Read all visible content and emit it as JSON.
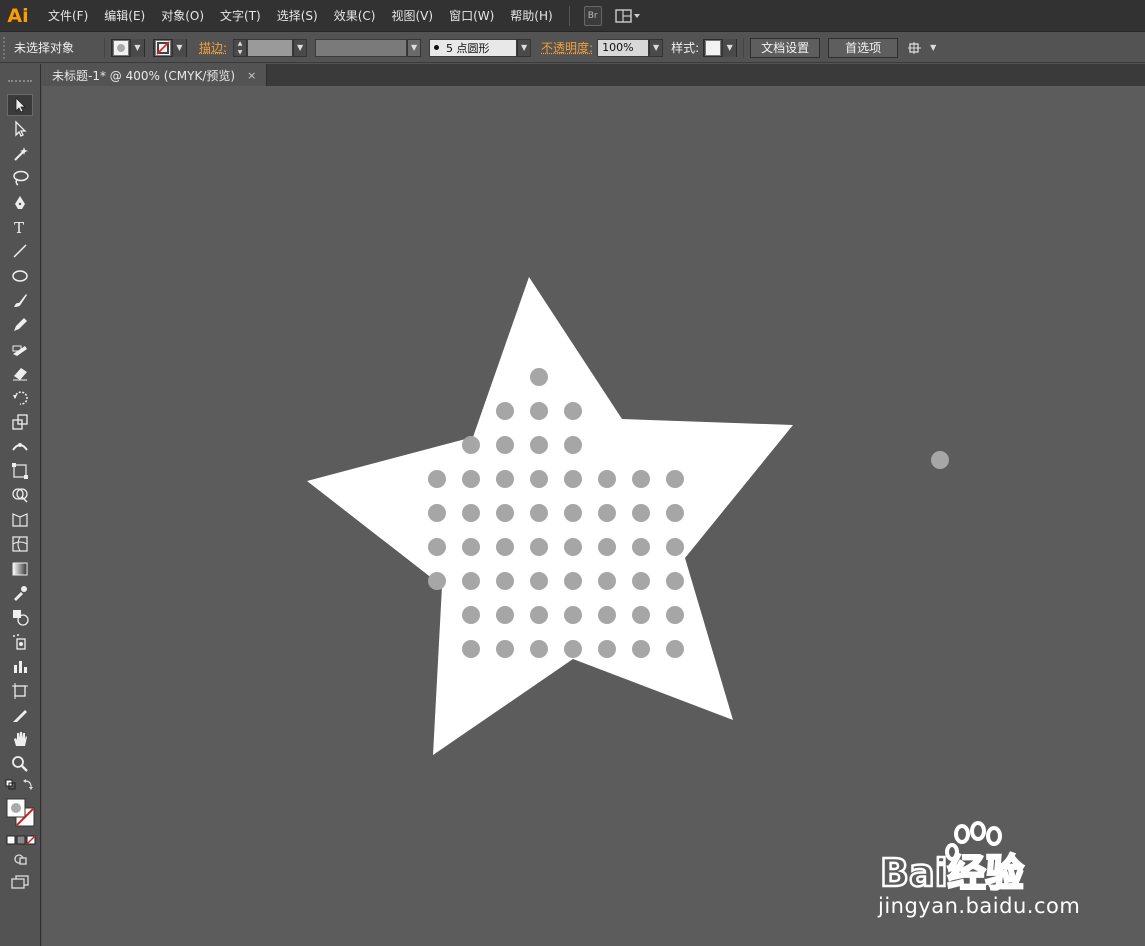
{
  "app": {
    "logo": "Ai",
    "accent_color": "#ff9a00"
  },
  "menu": {
    "items": [
      "文件(F)",
      "编辑(E)",
      "对象(O)",
      "文字(T)",
      "选择(S)",
      "效果(C)",
      "视图(V)",
      "窗口(W)",
      "帮助(H)"
    ],
    "bridge_label": "Br"
  },
  "controlbar": {
    "selection_label": "未选择对象",
    "stroke_label": "描边:",
    "brush_label": "5 点圆形",
    "opacity_label": "不透明度:",
    "opacity_value": "100%",
    "style_label": "样式:",
    "doc_setup_button": "文档设置",
    "preferences_button": "首选项"
  },
  "tab": {
    "title": "未标题-1* @ 400% (CMYK/预览)",
    "close": "×"
  },
  "tools": [
    "selection-tool-icon",
    "direct-selection-tool-icon",
    "magic-wand-tool-icon",
    "lasso-tool-icon",
    "pen-tool-icon",
    "type-tool-icon",
    "line-tool-icon",
    "ellipse-tool-icon",
    "paintbrush-tool-icon",
    "pencil-tool-icon",
    "blob-brush-tool-icon",
    "eraser-tool-icon",
    "rotate-tool-icon",
    "scale-tool-icon",
    "width-tool-icon",
    "free-transform-tool-icon",
    "shape-builder-tool-icon",
    "perspective-grid-tool-icon",
    "mesh-tool-icon",
    "gradient-tool-icon",
    "eyedropper-tool-icon",
    "blend-tool-icon",
    "symbol-sprayer-tool-icon",
    "column-graph-tool-icon",
    "artboard-tool-icon",
    "slice-tool-icon",
    "hand-tool-icon",
    "zoom-tool-icon"
  ],
  "canvas": {
    "background": "#5c5c5c",
    "star_color": "#ffffff",
    "dot_color": "#a6a6a6"
  },
  "watermark": {
    "brand": "Bai经验",
    "url": "jingyan.baidu.com"
  }
}
